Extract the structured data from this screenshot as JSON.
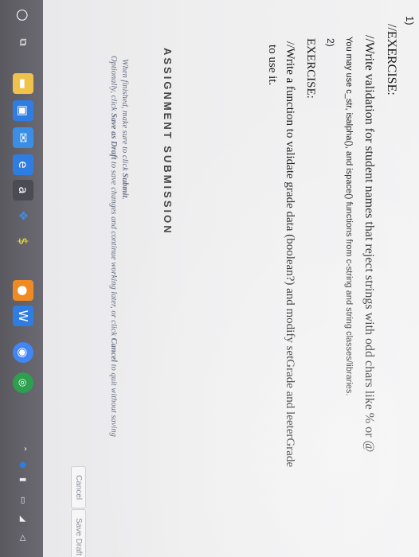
{
  "content": {
    "item_number": "1)",
    "ex1_title": "//EXERCISE:",
    "ex1_text": "//Write validation for student names that reject strings with odd chars like % or @",
    "ex1_note": "You may use c_str, isalpha(), and ispace() functions from c-string and string classes/libraries.",
    "item2_number": "2)",
    "ex2_title": "EXERCISE:",
    "ex2_text_line1": "//Write a function to validate grade data (boolean?) and modify setGrade and leeterGrade",
    "ex2_text_line2": "to use it."
  },
  "submission": {
    "heading": "ASSIGNMENT SUBMISSION",
    "instruction_line1_pre": "When finished, make sure to click ",
    "instruction_line1_bold": "Submit",
    "instruction_line1_post": ".",
    "instruction_line2_pre": "Optionally, click ",
    "instruction_line2_bold": "Save as Draft",
    "instruction_line2_post": " to save changes and continue working later, or click ",
    "instruction_line2_bold2": "Cancel",
    "instruction_line2_end": " to quit without saving",
    "cancel_label": "Cancel",
    "save_draft_label": "Save Draft"
  },
  "taskbar": {
    "items": [
      "start-icon",
      "search-icon",
      "task-view-icon",
      "folder-icon",
      "store-icon",
      "mail-icon",
      "edge-icon",
      "amazon-icon",
      "dropbox-icon",
      "app-icon",
      "firefox-icon",
      "word-icon",
      "chrome-icon"
    ],
    "tray_colors": {
      "start": "#ffffff",
      "accent": "#2f7de1"
    }
  }
}
